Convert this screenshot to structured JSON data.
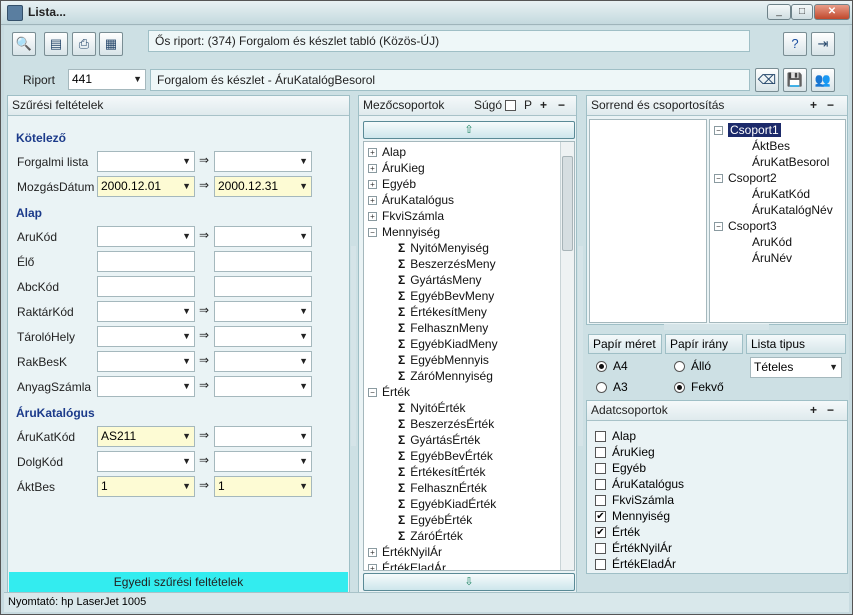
{
  "window": {
    "title": "Lista...",
    "min_icon": "minimize-icon",
    "max_icon": "maximize-icon",
    "close_icon": "close-icon"
  },
  "toolbar": {
    "parent_report": "Ős riport: (374)  Forgalom és készlet tabló (Közös-ÚJ)",
    "report_label": "Riport",
    "report_id": "441",
    "report_name": "Forgalom és készlet - ÁruKatalógBesorol"
  },
  "filters": {
    "title": "Szűrési feltételek",
    "arrow": "⇒",
    "sections": {
      "kotelezo": "Kötelező",
      "alap": "Alap",
      "arukatalogus": "ÁruKatalógus"
    },
    "fields": {
      "forgalmi_lista": {
        "label": "Forgalmi lista",
        "from": "",
        "to": ""
      },
      "mozgas_datum": {
        "label": "MozgásDátum",
        "from": "2000.12.01",
        "to": "2000.12.31"
      },
      "arukod": {
        "label": "AruKód",
        "from": "",
        "to": ""
      },
      "elo": {
        "label": "Élő",
        "from": "",
        "to": ""
      },
      "abckod": {
        "label": "AbcKód",
        "from": "",
        "to": ""
      },
      "raktarkod": {
        "label": "RaktárKód",
        "from": "",
        "to": ""
      },
      "tarolohely": {
        "label": "TárolóHely",
        "from": "",
        "to": ""
      },
      "rakbesk": {
        "label": "RakBesK",
        "from": "",
        "to": ""
      },
      "anyagszamla": {
        "label": "AnyagSzámla",
        "from": "",
        "to": ""
      },
      "arukatkod": {
        "label": "ÁruKatKód",
        "from": "AS211",
        "to": ""
      },
      "dolgkod": {
        "label": "DolgKód",
        "from": "",
        "to": ""
      },
      "aktbes": {
        "label": "ÁktBes",
        "from": "1",
        "to": "1"
      }
    },
    "custom_button": "Egyedi szűrési feltételek"
  },
  "fieldgroups": {
    "title": "Mezőcsoportok",
    "help_label": "Súgó",
    "p_label": "P",
    "items": [
      {
        "kind": "group",
        "label": "Alap",
        "state": "+"
      },
      {
        "kind": "group",
        "label": "ÁruKieg",
        "state": "+"
      },
      {
        "kind": "group",
        "label": "Egyéb",
        "state": "+"
      },
      {
        "kind": "group",
        "label": "ÁruKatalógus",
        "state": "+"
      },
      {
        "kind": "group",
        "label": "FkviSzámla",
        "state": "+"
      },
      {
        "kind": "group",
        "label": "Mennyiség",
        "state": "−"
      },
      {
        "kind": "field",
        "label": "NyitóMenyiség"
      },
      {
        "kind": "field",
        "label": "BeszerzésMeny"
      },
      {
        "kind": "field",
        "label": "GyártásMeny"
      },
      {
        "kind": "field",
        "label": "EgyébBevMeny"
      },
      {
        "kind": "field",
        "label": "ÉrtékesítMeny"
      },
      {
        "kind": "field",
        "label": "FelhasznMeny"
      },
      {
        "kind": "field",
        "label": "EgyébKiadMeny"
      },
      {
        "kind": "field",
        "label": "EgyébMennyis"
      },
      {
        "kind": "field",
        "label": "ZáróMennyiség"
      },
      {
        "kind": "group",
        "label": "Érték",
        "state": "−"
      },
      {
        "kind": "field",
        "label": "NyitóÉrték"
      },
      {
        "kind": "field",
        "label": "BeszerzésÉrték"
      },
      {
        "kind": "field",
        "label": "GyártásÉrték"
      },
      {
        "kind": "field",
        "label": "EgyébBevÉrték"
      },
      {
        "kind": "field",
        "label": "ÉrtékesítÉrték"
      },
      {
        "kind": "field",
        "label": "FelhasznÉrték"
      },
      {
        "kind": "field",
        "label": "EgyébKiadÉrték"
      },
      {
        "kind": "field",
        "label": "EgyébÉrték"
      },
      {
        "kind": "field",
        "label": "ZáróÉrték"
      },
      {
        "kind": "group",
        "label": "ÉrtékNyilÁr",
        "state": "+"
      },
      {
        "kind": "group",
        "label": "ÉrtékEladÁr",
        "state": "+"
      }
    ]
  },
  "sorting": {
    "title": "Sorrend és csoportosítás",
    "groups": [
      {
        "label": "Csoport1",
        "selected": true,
        "children": [
          "ÁktBes",
          "ÁruKatBesorol"
        ]
      },
      {
        "label": "Csoport2",
        "selected": false,
        "children": [
          "ÁruKatKód",
          "ÁruKatalógNév"
        ]
      },
      {
        "label": "Csoport3",
        "selected": false,
        "children": [
          "AruKód",
          "ÁruNév"
        ]
      }
    ]
  },
  "paper": {
    "size_label": "Papír méret",
    "orientation_label": "Papír irány",
    "list_type_label": "Lista tipus",
    "size_a4": "A4",
    "size_a3": "A3",
    "orient_portrait": "Álló",
    "orient_landscape": "Fekvő",
    "list_type_value": "Tételes",
    "selected_size": "A4",
    "selected_orientation": "Fekvő"
  },
  "datagroups": {
    "title": "Adatcsoportok",
    "items": [
      {
        "label": "Alap",
        "checked": false
      },
      {
        "label": "ÁruKieg",
        "checked": false
      },
      {
        "label": "Egyéb",
        "checked": false
      },
      {
        "label": "ÁruKatalógus",
        "checked": false
      },
      {
        "label": "FkviSzámla",
        "checked": false
      },
      {
        "label": "Mennyiség",
        "checked": true
      },
      {
        "label": "Érték",
        "checked": true
      },
      {
        "label": "ÉrtékNyilÁr",
        "checked": false
      },
      {
        "label": "ÉrtékEladÁr",
        "checked": false
      }
    ]
  },
  "status": {
    "printer": "Nyomtató: hp LaserJet 1005"
  }
}
